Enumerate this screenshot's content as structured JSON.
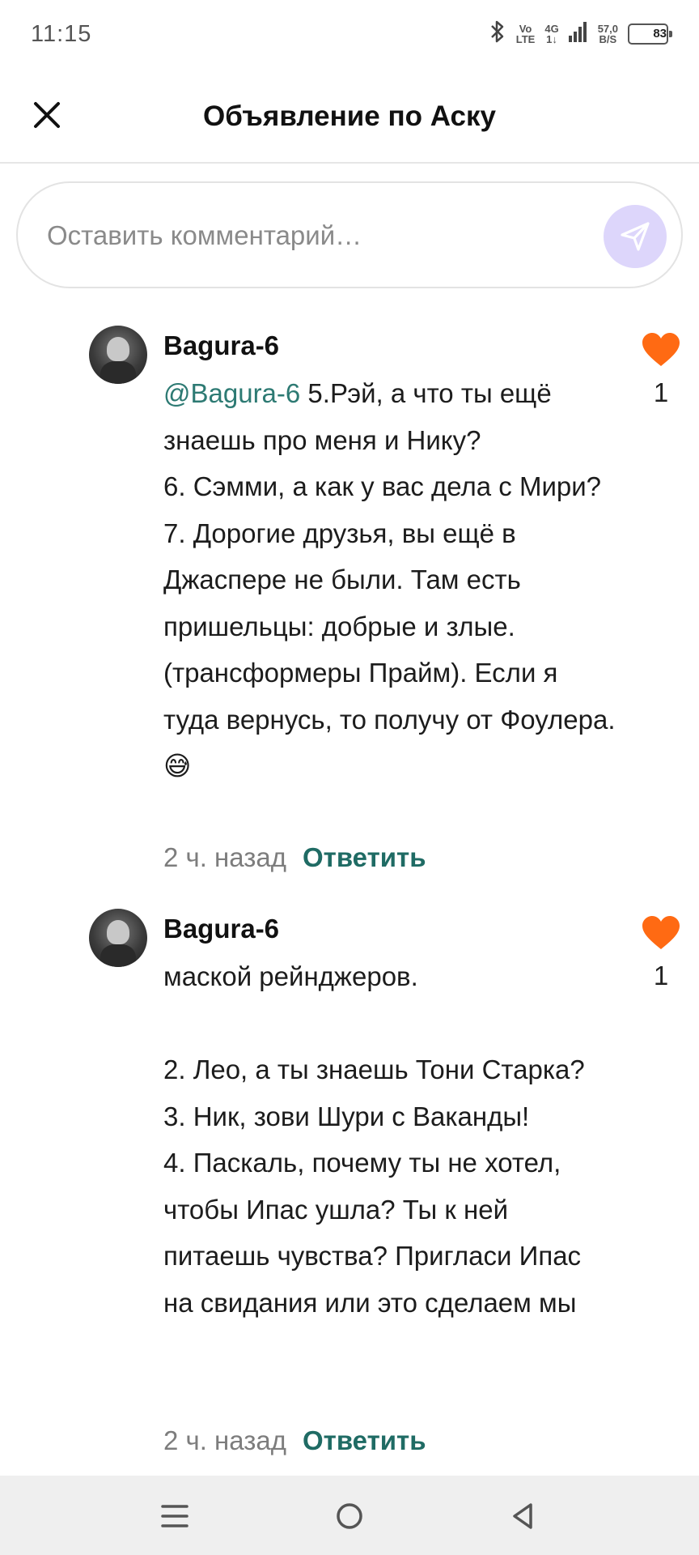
{
  "status_bar": {
    "time": "11:15",
    "volte": [
      "Vo",
      "LTE"
    ],
    "network": [
      "4G",
      "1↓"
    ],
    "speed": [
      "57,0",
      "B/S"
    ],
    "battery": "83"
  },
  "header": {
    "title": "Объявление по Аску"
  },
  "comment_input": {
    "placeholder": "Оставить комментарий…"
  },
  "comments": [
    {
      "username": "Bagura-6",
      "mention": "@Bagura-6",
      "text": " 5.Рэй, а что ты ещё знаешь про меня и Нику?\n6. Сэмми, а как у вас дела с Мири?\n7. Дорогие друзья, вы ещё в Джаспере не были. Там есть пришельцы: добрые и злые. (трансформеры Прайм). Если я туда вернусь, то получу от Фоулера.😅",
      "time": "2 ч. назад",
      "reply_label": "Ответить",
      "likes": "1"
    },
    {
      "username": "Bagura-6",
      "mention": "",
      "text": "маской рейнджеров.\n\n2. Лео, а ты знаешь Тони Старка?\n3. Ник, зови Шури с Ваканды!\n4. Паскаль, почему ты не хотел, чтобы Ипас ушла? Ты к ней питаешь чувства? Пригласи Ипас на свидания или это сделаем мы",
      "time": "2 ч. назад",
      "reply_label": "Ответить",
      "likes": "1"
    }
  ],
  "colors": {
    "accent": "#1f6b64",
    "mention": "#2d7a73",
    "heart": "#ff6a13",
    "send_bg": "#ddd6fb"
  },
  "icons": [
    "close-icon",
    "send-icon",
    "heart-icon",
    "menu-icon",
    "home-icon",
    "back-icon",
    "bluetooth-icon",
    "signal-icon",
    "battery-icon"
  ]
}
